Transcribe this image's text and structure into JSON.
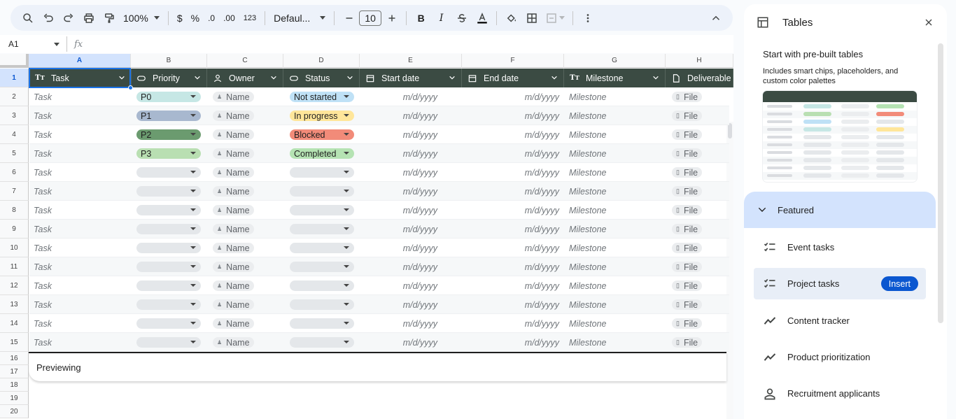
{
  "toolbar": {
    "zoom": "100%",
    "currency": "$",
    "percent": "%",
    "dec_less": ".0",
    "dec_more": ".00",
    "number_format": "123",
    "font": "Defaul...",
    "font_size": "10",
    "bold": "B",
    "italic": "I"
  },
  "namebox": {
    "cell": "A1",
    "fx": "fx"
  },
  "columns": [
    "A",
    "B",
    "C",
    "D",
    "E",
    "F",
    "G",
    "H"
  ],
  "rows": [
    "1",
    "2",
    "3",
    "4",
    "5",
    "6",
    "7",
    "8",
    "9",
    "10",
    "11",
    "12",
    "13",
    "14",
    "15",
    "16",
    "17",
    "18",
    "19",
    "20"
  ],
  "table_headers": [
    {
      "label": "Task",
      "icon": "text-icon"
    },
    {
      "label": "Priority",
      "icon": "dropdown-chip-icon"
    },
    {
      "label": "Owner",
      "icon": "person-icon"
    },
    {
      "label": "Status",
      "icon": "dropdown-chip-icon"
    },
    {
      "label": "Start date",
      "icon": "calendar-icon"
    },
    {
      "label": "End date",
      "icon": "calendar-icon"
    },
    {
      "label": "Milestone",
      "icon": "text-icon"
    },
    {
      "label": "Deliverable",
      "icon": "file-icon"
    }
  ],
  "placeholders": {
    "task": "Task",
    "owner": "Name",
    "date": "m/d/yyyy",
    "milestone": "Milestone",
    "file": "File"
  },
  "priority_chips": [
    {
      "label": "P0",
      "color": "#c6e7e5"
    },
    {
      "label": "P1",
      "color": "#a8b8cf"
    },
    {
      "label": "P2",
      "color": "#6b9b6f"
    },
    {
      "label": "P3",
      "color": "#b9dfb2"
    }
  ],
  "status_chips": [
    {
      "label": "Not started",
      "color": "#bfe1f6"
    },
    {
      "label": "In progress",
      "color": "#ffe69a"
    },
    {
      "label": "Blocked",
      "color": "#f28b79"
    },
    {
      "label": "Completed",
      "color": "#b5e3b3"
    }
  ],
  "empty_chip_color": "#e4e7ea",
  "preview_label": "Previewing",
  "panel": {
    "title": "Tables",
    "subtitle": "Start with pre-built tables",
    "description": "Includes smart chips, placeholders, and custom color palettes",
    "featured": "Featured",
    "items": [
      {
        "label": "Event tasks",
        "icon": "checklist-icon"
      },
      {
        "label": "Project tasks",
        "icon": "checklist-icon"
      },
      {
        "label": "Content tracker",
        "icon": "trend-icon"
      },
      {
        "label": "Product prioritization",
        "icon": "trend-icon"
      },
      {
        "label": "Recruitment applicants",
        "icon": "person-icon"
      }
    ],
    "insert": "Insert"
  },
  "colors": {
    "table_header": "#3b4b43",
    "selection": "#1a73e8",
    "insert_button": "#0b57d0"
  }
}
